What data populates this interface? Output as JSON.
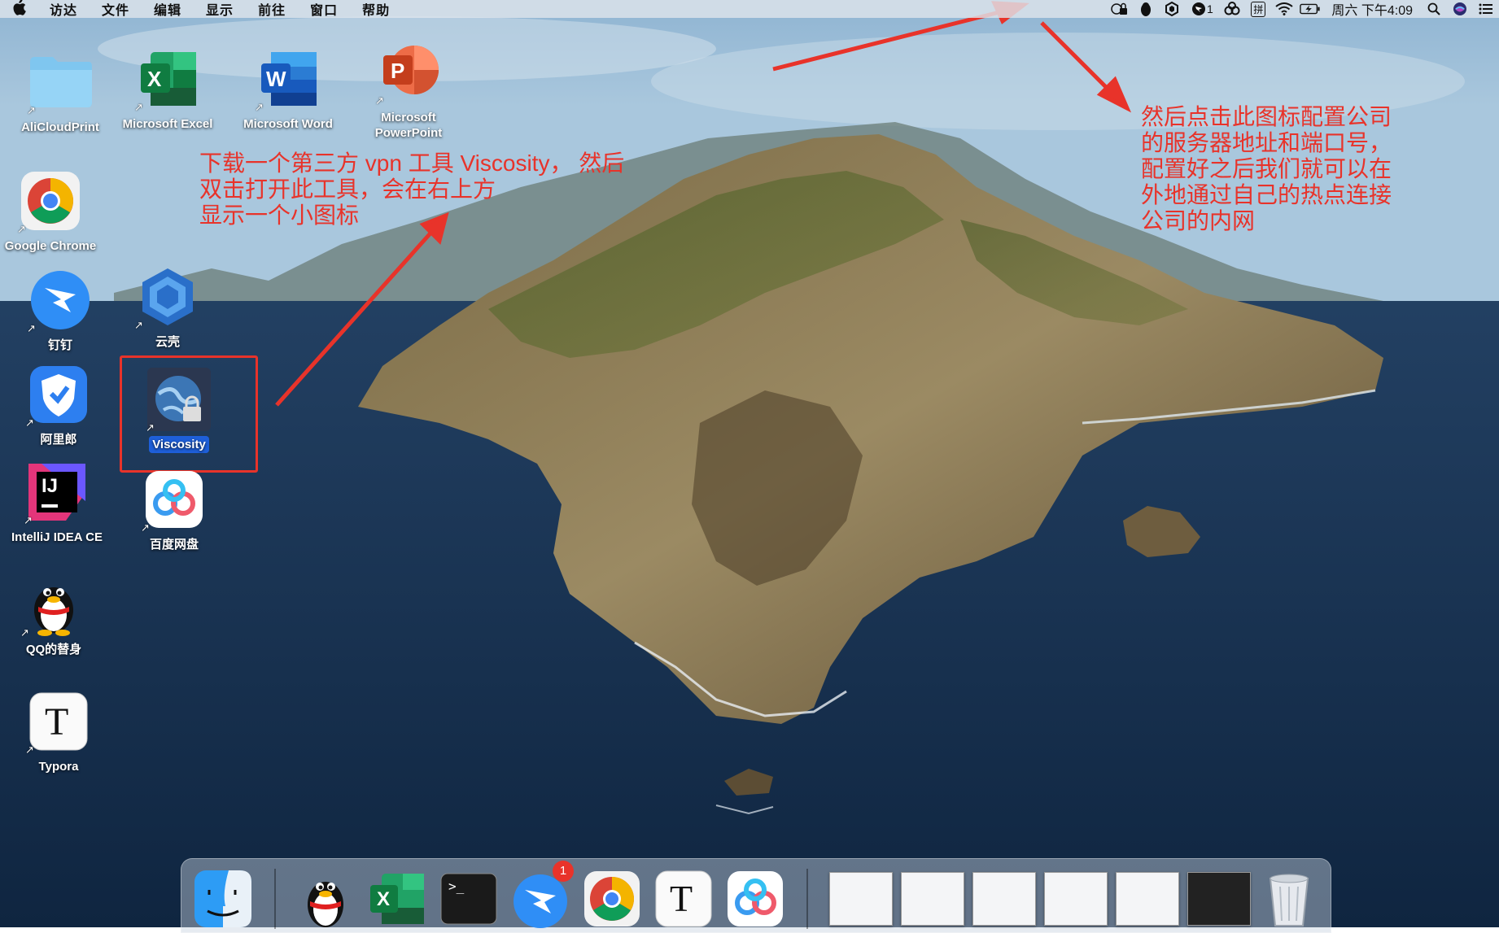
{
  "menubar": {
    "apple": "",
    "items": [
      "访达",
      "文件",
      "编辑",
      "显示",
      "前往",
      "窗口",
      "帮助"
    ],
    "status": {
      "im": "拼",
      "datetime": "周六 下午4:09",
      "badge": "1"
    }
  },
  "desktop": {
    "icons": [
      {
        "label": "AliCloudPrint"
      },
      {
        "label": "Microsoft Excel"
      },
      {
        "label": "Microsoft Word"
      },
      {
        "label": "Microsoft PowerPoint"
      },
      {
        "label": "Google Chrome"
      },
      {
        "label": "钉钉"
      },
      {
        "label": "云壳"
      },
      {
        "label": "阿里郎"
      },
      {
        "label": "Viscosity"
      },
      {
        "label": "IntelliJ IDEA CE"
      },
      {
        "label": "百度网盘"
      },
      {
        "label": "QQ的替身"
      },
      {
        "label": "Typora"
      }
    ],
    "glyphs": {
      "excel": "X",
      "word": "W",
      "ppt": "P",
      "ij": "IJ",
      "typora": "T"
    }
  },
  "annotations": {
    "left": [
      "下载一个第三方 vpn 工具 Viscosity， 然后",
      "双击打开此工具，会在右上方",
      "显示一个小图标"
    ],
    "right": [
      "然后点击此图标配置公司",
      "的服务器地址和端口号，",
      "配置好之后我们就可以在",
      "外地通过自己的热点连接",
      "公司的内网"
    ],
    "color": "#e8332a"
  },
  "dock": {
    "badge": "1",
    "terminal_prompt": ">_",
    "excel_glyph": "X",
    "typora_glyph": "T"
  }
}
